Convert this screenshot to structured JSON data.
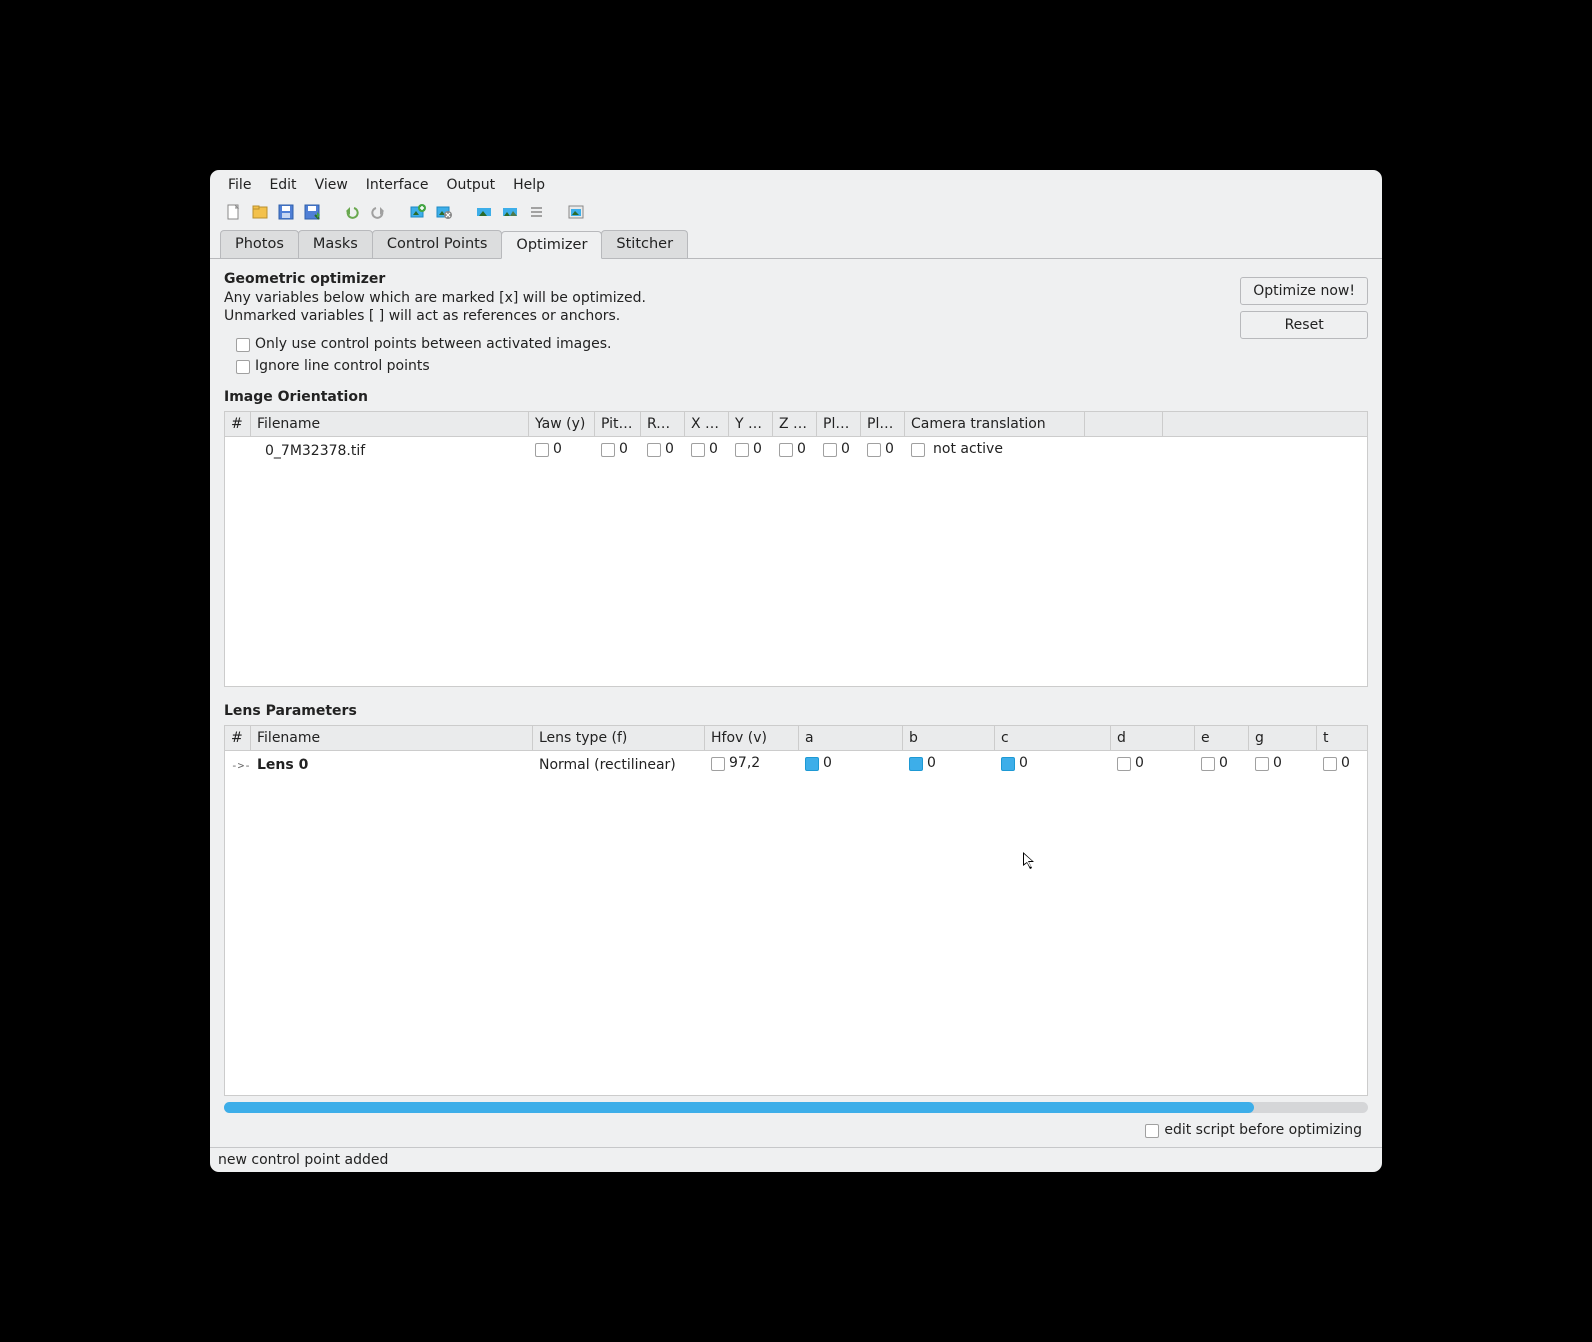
{
  "menu": [
    "File",
    "Edit",
    "View",
    "Interface",
    "Output",
    "Help"
  ],
  "tabs": [
    "Photos",
    "Masks",
    "Control Points",
    "Optimizer",
    "Stitcher"
  ],
  "activeTab": 3,
  "optimizer": {
    "title": "Geometric optimizer",
    "desc1": "Any variables below which are marked [x] will be optimized.",
    "desc2": "Unmarked variables [ ] will act as references or anchors.",
    "onlyActive": "Only use control points between activated images.",
    "ignoreLine": "Ignore line control points",
    "optimizeBtn": "Optimize now!",
    "resetBtn": "Reset"
  },
  "orientation": {
    "heading": "Image Orientation",
    "cols": [
      "#",
      "Filename",
      "Yaw (y)",
      "Pitc...",
      "Roll...",
      "X (T...",
      "Y (T...",
      "Z (T...",
      "Pla...",
      "Pla...",
      "Camera translation",
      "",
      ""
    ],
    "row": {
      "filename": "0_7M32378.tif",
      "yaw": "0",
      "pitch": "0",
      "roll": "0",
      "x": "0",
      "y": "0",
      "z": "0",
      "pla1": "0",
      "pla2": "0",
      "cam": "not active"
    }
  },
  "lens": {
    "heading": "Lens Parameters",
    "cols": [
      "#",
      "Filename",
      "Lens type (f)",
      "Hfov (v)",
      "a",
      "b",
      "c",
      "d",
      "e",
      "g",
      "t"
    ],
    "row": {
      "name": "Lens 0",
      "type": "Normal (rectilinear)",
      "hfov": "97,2",
      "a": "0",
      "b": "0",
      "c": "0",
      "d": "0",
      "e": "0",
      "g": "0",
      "t": "0",
      "aChecked": true,
      "bChecked": true,
      "cPartial": true
    }
  },
  "editScript": "edit script before optimizing",
  "status": "new control point added"
}
